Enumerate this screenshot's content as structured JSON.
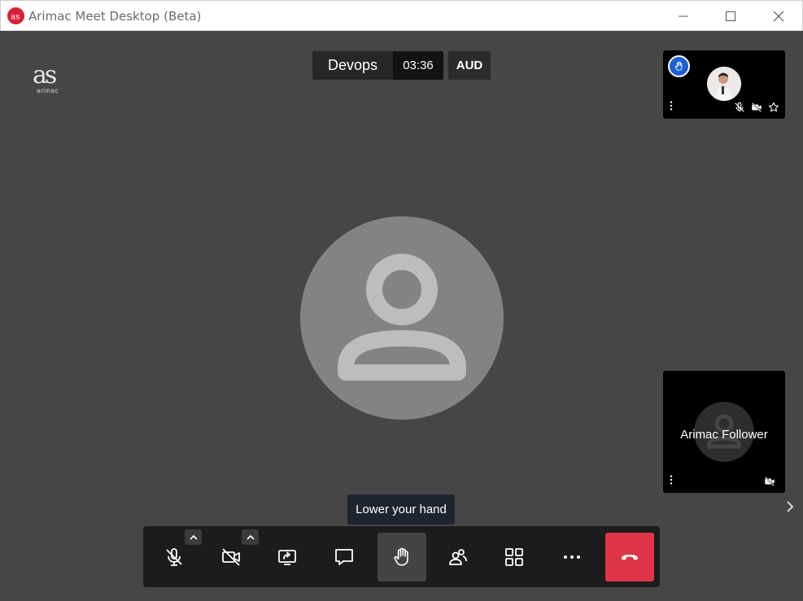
{
  "window": {
    "title": "Arimac Meet Desktop (Beta)",
    "app_icon": "arimac-logo-icon",
    "controls": [
      "minimize-icon",
      "maximize-icon",
      "close-icon"
    ]
  },
  "logo": {
    "mark": "as",
    "text": "arimac"
  },
  "meeting": {
    "name": "Devops",
    "elapsed": "03:36",
    "audio_button": "AUD"
  },
  "main_participant": {
    "avatar": "person-placeholder-icon"
  },
  "tiles": [
    {
      "raised_hand": true,
      "avatar": "photo",
      "muted": true,
      "video_off": true,
      "icons": [
        "hand-icon",
        "more-vert-icon",
        "mic-off-icon",
        "video-off-icon",
        "star-icon"
      ]
    },
    {
      "name": "Arimac Follower",
      "avatar": "person-placeholder-icon",
      "video_off": true,
      "icons": [
        "more-vert-icon",
        "video-off-icon"
      ]
    }
  ],
  "tooltip": "Lower your hand",
  "toolbar": {
    "buttons": [
      "mic-off-icon",
      "video-off-icon",
      "screen-share-icon",
      "chat-icon",
      "hand-icon",
      "participants-icon",
      "grid-view-icon",
      "more-horiz-icon",
      "end-call-icon"
    ],
    "active": "hand-icon"
  },
  "colors": {
    "end_call": "#df3548",
    "hand_badge": "#1d5fd1",
    "brand": "#d8203a"
  }
}
